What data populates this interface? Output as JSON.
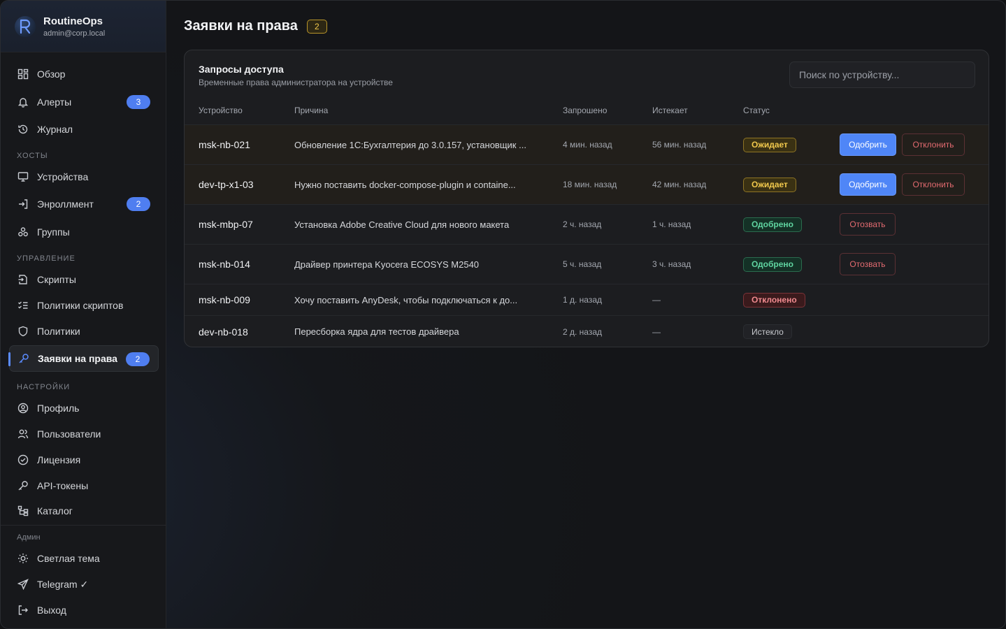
{
  "app": {
    "name": "RoutineOps",
    "user": "admin@corp.local"
  },
  "sidebar": {
    "main": [
      {
        "label": "Обзор",
        "icon": "dashboard-icon"
      },
      {
        "label": "Алерты",
        "icon": "bell-icon",
        "badge": "3"
      },
      {
        "label": "Журнал",
        "icon": "history-icon"
      }
    ],
    "hosts_label": "ХОСТЫ",
    "hosts": [
      {
        "label": "Устройства",
        "icon": "monitor-icon"
      },
      {
        "label": "Энроллмент",
        "icon": "login-icon",
        "badge": "2"
      },
      {
        "label": "Группы",
        "icon": "groups-icon"
      }
    ],
    "manage_label": "УПРАВЛЕНИЕ",
    "manage": [
      {
        "label": "Скрипты",
        "icon": "script-icon"
      },
      {
        "label": "Политики скриптов",
        "icon": "list-check-icon"
      },
      {
        "label": "Политики",
        "icon": "shield-icon"
      },
      {
        "label": "Заявки на права",
        "icon": "key-icon",
        "badge": "2",
        "active": true
      }
    ],
    "settings_label": "НАСТРОЙКИ",
    "settings": [
      {
        "label": "Профиль",
        "icon": "user-circle-icon"
      },
      {
        "label": "Пользователи",
        "icon": "users-icon"
      },
      {
        "label": "Лицензия",
        "icon": "badge-check-icon"
      },
      {
        "label": "API-токены",
        "icon": "key-icon"
      },
      {
        "label": "Каталог",
        "icon": "tree-icon"
      }
    ],
    "admin_label": "Админ",
    "footer": [
      {
        "label": "Светлая тема",
        "icon": "sun-icon"
      },
      {
        "label": "Telegram ✓",
        "icon": "send-icon"
      },
      {
        "label": "Выход",
        "icon": "logout-icon"
      }
    ]
  },
  "page": {
    "title": "Заявки на права",
    "count": "2"
  },
  "card": {
    "title": "Запросы доступа",
    "subtitle": "Временные права администратора на устройстве",
    "search_placeholder": "Поиск по устройству...",
    "columns": {
      "device": "Устройство",
      "reason": "Причина",
      "requested": "Запрошено",
      "expires": "Истекает",
      "status": "Статус"
    },
    "rows": [
      {
        "device": "msk-nb-021",
        "reason": "Обновление 1С:Бухгалтерия до 3.0.157, установщик ...",
        "requested": "4 мин. назад",
        "expires": "56 мин. назад",
        "status": "Ожидает",
        "kind": "wait"
      },
      {
        "device": "dev-tp-x1-03",
        "reason": "Нужно поставить docker-compose-plugin и containe...",
        "requested": "18 мин. назад",
        "expires": "42 мин. назад",
        "status": "Ожидает",
        "kind": "wait"
      },
      {
        "device": "msk-mbp-07",
        "reason": "Установка Adobe Creative Cloud для нового макета",
        "requested": "2 ч. назад",
        "expires": "1 ч. назад",
        "status": "Одобрено",
        "kind": "ok"
      },
      {
        "device": "msk-nb-014",
        "reason": "Драйвер принтера Kyocera ECOSYS M2540",
        "requested": "5 ч. назад",
        "expires": "3 ч. назад",
        "status": "Одобрено",
        "kind": "ok"
      },
      {
        "device": "msk-nb-009",
        "reason": "Хочу поставить AnyDesk, чтобы подключаться к до...",
        "requested": "1 д. назад",
        "expires": "—",
        "status": "Отклонено",
        "kind": "rej"
      },
      {
        "device": "dev-nb-018",
        "reason": "Пересборка ядра для тестов драйвера",
        "requested": "2 д. назад",
        "expires": "—",
        "status": "Истекло",
        "kind": "exp"
      }
    ],
    "actions": {
      "approve": "Одобрить",
      "reject": "Отклонить",
      "revoke": "Отозвать"
    }
  },
  "colors": {
    "accent": "#4f86f7",
    "pending": "#f2c94c",
    "approved": "#5fd4a0",
    "rejected": "#f08a8f"
  }
}
